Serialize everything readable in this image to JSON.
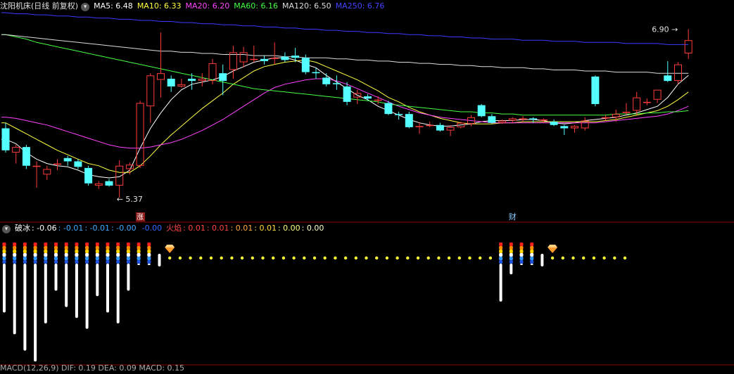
{
  "stock": {
    "title": "沈阳机床(日线 前复权)",
    "ma_legend": [
      {
        "label": "MA5: 6.48",
        "color": "#ffffff"
      },
      {
        "label": "MA10: 6.33",
        "color": "#ffff44"
      },
      {
        "label": "MA20: 6.20",
        "color": "#ff44ff"
      },
      {
        "label": "MA60: 6.16",
        "color": "#44ff44"
      },
      {
        "label": "MA120: 6.50",
        "color": "#dddddd"
      },
      {
        "label": "MA250: 6.76",
        "color": "#4444ff"
      }
    ],
    "high_label": "6.90",
    "low_label": "5.37",
    "markers": {
      "rise": "涨",
      "finance": "财"
    }
  },
  "indicator": {
    "name": "破冰",
    "values": [
      {
        "label": ": -0.06",
        "color": "#ffffff"
      },
      {
        "label": ": -0.01",
        "color": "#44aaff"
      },
      {
        "label": ": -0.01",
        "color": "#44aaff"
      },
      {
        "label": ": -0.00",
        "color": "#44aaff"
      },
      {
        "label": "-0.00",
        "color": "#3366ff"
      }
    ],
    "fire_name": "火焰",
    "fire_values": [
      {
        "label": ": 0.01",
        "color": "#ff4444"
      },
      {
        "label": ": 0.01",
        "color": "#ff4444"
      },
      {
        "label": ": 0.01",
        "color": "#ffaa44"
      },
      {
        "label": ": 0.01",
        "color": "#ffdd44"
      },
      {
        "label": ": 0.00",
        "color": "#ffff88"
      },
      {
        "label": ": 0.00",
        "color": "#ffffcc"
      }
    ],
    "bottom_text": "MACD(12,26,9)  DIF: 0.19  DEA: 0.09  MACD: 0.15"
  },
  "colors": {
    "up": "#ff3b3b",
    "down": "#54ffff",
    "bg": "#000000",
    "divider": "#8b0000"
  },
  "chart_data": [
    {
      "type": "candlestick",
      "title": "沈阳机床(日线 前复权)",
      "ylim": [
        5.25,
        7.05
      ],
      "candles": [
        {
          "o": 6.0,
          "h": 6.05,
          "l": 5.78,
          "c": 5.8
        },
        {
          "o": 5.78,
          "h": 5.85,
          "l": 5.68,
          "c": 5.83
        },
        {
          "o": 5.83,
          "h": 5.85,
          "l": 5.63,
          "c": 5.66
        },
        {
          "o": 5.66,
          "h": 5.7,
          "l": 5.46,
          "c": 5.66
        },
        {
          "o": 5.58,
          "h": 5.66,
          "l": 5.53,
          "c": 5.63
        },
        {
          "o": 5.68,
          "h": 5.72,
          "l": 5.62,
          "c": 5.68
        },
        {
          "o": 5.73,
          "h": 5.75,
          "l": 5.66,
          "c": 5.7
        },
        {
          "o": 5.7,
          "h": 5.72,
          "l": 5.63,
          "c": 5.65
        },
        {
          "o": 5.64,
          "h": 5.66,
          "l": 5.48,
          "c": 5.5
        },
        {
          "o": 5.48,
          "h": 5.52,
          "l": 5.45,
          "c": 5.5
        },
        {
          "o": 5.52,
          "h": 5.54,
          "l": 5.47,
          "c": 5.48
        },
        {
          "o": 5.48,
          "h": 5.71,
          "l": 5.37,
          "c": 5.66
        },
        {
          "o": 5.63,
          "h": 5.69,
          "l": 5.58,
          "c": 5.67
        },
        {
          "o": 5.66,
          "h": 6.25,
          "l": 5.64,
          "c": 6.23
        },
        {
          "o": 6.2,
          "h": 6.5,
          "l": 6.05,
          "c": 6.48
        },
        {
          "o": 6.44,
          "h": 6.87,
          "l": 6.28,
          "c": 6.5
        },
        {
          "o": 6.45,
          "h": 6.48,
          "l": 6.33,
          "c": 6.38
        },
        {
          "o": 6.38,
          "h": 6.45,
          "l": 6.37,
          "c": 6.4
        },
        {
          "o": 6.45,
          "h": 6.5,
          "l": 6.35,
          "c": 6.43
        },
        {
          "o": 6.43,
          "h": 6.5,
          "l": 6.38,
          "c": 6.45
        },
        {
          "o": 6.43,
          "h": 6.63,
          "l": 6.4,
          "c": 6.59
        },
        {
          "o": 6.5,
          "h": 6.58,
          "l": 6.3,
          "c": 6.43
        },
        {
          "o": 6.53,
          "h": 6.75,
          "l": 6.45,
          "c": 6.69
        },
        {
          "o": 6.6,
          "h": 6.74,
          "l": 6.55,
          "c": 6.69
        },
        {
          "o": 6.63,
          "h": 6.75,
          "l": 6.6,
          "c": 6.63
        },
        {
          "o": 6.63,
          "h": 6.66,
          "l": 6.58,
          "c": 6.61
        },
        {
          "o": 6.63,
          "h": 6.78,
          "l": 6.58,
          "c": 6.64
        },
        {
          "o": 6.65,
          "h": 6.69,
          "l": 6.6,
          "c": 6.62
        },
        {
          "o": 6.66,
          "h": 6.73,
          "l": 6.6,
          "c": 6.64
        },
        {
          "o": 6.64,
          "h": 6.67,
          "l": 6.49,
          "c": 6.51
        },
        {
          "o": 6.51,
          "h": 6.55,
          "l": 6.45,
          "c": 6.5
        },
        {
          "o": 6.46,
          "h": 6.5,
          "l": 6.38,
          "c": 6.4
        },
        {
          "o": 6.41,
          "h": 6.48,
          "l": 6.35,
          "c": 6.4
        },
        {
          "o": 6.38,
          "h": 6.42,
          "l": 6.21,
          "c": 6.24
        },
        {
          "o": 6.28,
          "h": 6.35,
          "l": 6.22,
          "c": 6.32
        },
        {
          "o": 6.29,
          "h": 6.31,
          "l": 6.25,
          "c": 6.27
        },
        {
          "o": 6.26,
          "h": 6.29,
          "l": 6.22,
          "c": 6.26
        },
        {
          "o": 6.23,
          "h": 6.25,
          "l": 6.12,
          "c": 6.13
        },
        {
          "o": 6.13,
          "h": 6.15,
          "l": 6.08,
          "c": 6.12
        },
        {
          "o": 6.13,
          "h": 6.15,
          "l": 6.0,
          "c": 6.01
        },
        {
          "o": 6.01,
          "h": 6.05,
          "l": 5.95,
          "c": 6.02
        },
        {
          "o": 6.03,
          "h": 6.06,
          "l": 6.01,
          "c": 6.03
        },
        {
          "o": 6.03,
          "h": 6.05,
          "l": 5.97,
          "c": 5.98
        },
        {
          "o": 5.98,
          "h": 6.03,
          "l": 5.93,
          "c": 6.01
        },
        {
          "o": 6.01,
          "h": 6.06,
          "l": 6.0,
          "c": 6.05
        },
        {
          "o": 6.04,
          "h": 6.12,
          "l": 6.02,
          "c": 6.1
        },
        {
          "o": 6.21,
          "h": 6.22,
          "l": 6.1,
          "c": 6.11
        },
        {
          "o": 6.11,
          "h": 6.13,
          "l": 6.04,
          "c": 6.05
        },
        {
          "o": 6.05,
          "h": 6.08,
          "l": 6.04,
          "c": 6.07
        },
        {
          "o": 6.07,
          "h": 6.1,
          "l": 6.05,
          "c": 6.09
        },
        {
          "o": 6.09,
          "h": 6.11,
          "l": 6.06,
          "c": 6.09
        },
        {
          "o": 6.09,
          "h": 6.1,
          "l": 6.05,
          "c": 6.08
        },
        {
          "o": 6.08,
          "h": 6.09,
          "l": 6.05,
          "c": 6.08
        },
        {
          "o": 6.06,
          "h": 6.08,
          "l": 6.02,
          "c": 6.03
        },
        {
          "o": 6.02,
          "h": 6.03,
          "l": 5.94,
          "c": 6.0
        },
        {
          "o": 6.0,
          "h": 6.03,
          "l": 5.96,
          "c": 6.02
        },
        {
          "o": 6.0,
          "h": 6.1,
          "l": 5.98,
          "c": 6.07
        },
        {
          "o": 6.47,
          "h": 6.48,
          "l": 6.2,
          "c": 6.22
        },
        {
          "o": 6.09,
          "h": 6.12,
          "l": 6.07,
          "c": 6.1
        },
        {
          "o": 6.1,
          "h": 6.17,
          "l": 6.06,
          "c": 6.13
        },
        {
          "o": 6.14,
          "h": 6.23,
          "l": 6.12,
          "c": 6.15
        },
        {
          "o": 6.16,
          "h": 6.33,
          "l": 6.12,
          "c": 6.28
        },
        {
          "o": 6.23,
          "h": 6.27,
          "l": 6.21,
          "c": 6.24
        },
        {
          "o": 6.26,
          "h": 6.35,
          "l": 6.23,
          "c": 6.35
        },
        {
          "o": 6.48,
          "h": 6.61,
          "l": 6.42,
          "c": 6.43
        },
        {
          "o": 6.43,
          "h": 6.6,
          "l": 6.4,
          "c": 6.58
        },
        {
          "o": 6.68,
          "h": 6.9,
          "l": 6.63,
          "c": 6.8
        }
      ],
      "ma": {
        "MA5": [
          5.9,
          5.86,
          5.78,
          5.72,
          5.68,
          5.66,
          5.65,
          5.62,
          5.58,
          5.56,
          5.55,
          5.56,
          5.62,
          5.82,
          6.0,
          6.14,
          6.26,
          6.35,
          6.4,
          6.42,
          6.44,
          6.47,
          6.52,
          6.56,
          6.6,
          6.62,
          6.64,
          6.64,
          6.62,
          6.58,
          6.55,
          6.48,
          6.42,
          6.36,
          6.3,
          6.26,
          6.2,
          6.16,
          6.12,
          6.08,
          6.05,
          6.03,
          6.02,
          6.02,
          6.03,
          6.04,
          6.06,
          6.07,
          6.07,
          6.07,
          6.08,
          6.08,
          6.07,
          6.05,
          6.04,
          6.05,
          6.07,
          6.08,
          6.09,
          6.1,
          6.12,
          6.14,
          6.17,
          6.2,
          6.28,
          6.4,
          6.48
        ],
        "MA10": [
          6.05,
          6.0,
          5.95,
          5.9,
          5.85,
          5.8,
          5.76,
          5.72,
          5.68,
          5.66,
          5.62,
          5.6,
          5.6,
          5.66,
          5.75,
          5.85,
          5.94,
          6.02,
          6.1,
          6.18,
          6.25,
          6.32,
          6.4,
          6.46,
          6.52,
          6.56,
          6.58,
          6.6,
          6.61,
          6.62,
          6.6,
          6.56,
          6.52,
          6.48,
          6.44,
          6.39,
          6.34,
          6.28,
          6.24,
          6.19,
          6.15,
          6.12,
          6.09,
          6.07,
          6.05,
          6.04,
          6.04,
          6.04,
          6.05,
          6.05,
          6.06,
          6.06,
          6.06,
          6.06,
          6.06,
          6.06,
          6.06,
          6.06,
          6.07,
          6.08,
          6.1,
          6.12,
          6.14,
          6.16,
          6.2,
          6.26,
          6.33
        ],
        "MA20": [
          6.1,
          6.09,
          6.07,
          6.05,
          6.03,
          6.0,
          5.97,
          5.94,
          5.91,
          5.88,
          5.85,
          5.83,
          5.82,
          5.82,
          5.83,
          5.85,
          5.87,
          5.9,
          5.94,
          5.98,
          6.03,
          6.08,
          6.14,
          6.2,
          6.26,
          6.32,
          6.37,
          6.4,
          6.42,
          6.44,
          6.45,
          6.45,
          6.43,
          6.4,
          6.36,
          6.32,
          6.28,
          6.24,
          6.2,
          6.17,
          6.14,
          6.12,
          6.1,
          6.09,
          6.08,
          6.07,
          6.06,
          6.05,
          6.05,
          6.05,
          6.05,
          6.05,
          6.05,
          6.05,
          6.05,
          6.05,
          6.05,
          6.05,
          6.06,
          6.07,
          6.08,
          6.09,
          6.1,
          6.11,
          6.13,
          6.16,
          6.2
        ],
        "MA60": [
          6.85,
          6.83,
          6.81,
          6.78,
          6.76,
          6.74,
          6.72,
          6.7,
          6.68,
          6.66,
          6.64,
          6.62,
          6.6,
          6.58,
          6.56,
          6.54,
          6.52,
          6.5,
          6.48,
          6.46,
          6.44,
          6.42,
          6.4,
          6.38,
          6.36,
          6.35,
          6.34,
          6.33,
          6.32,
          6.31,
          6.3,
          6.29,
          6.28,
          6.27,
          6.26,
          6.25,
          6.24,
          6.22,
          6.21,
          6.2,
          6.19,
          6.18,
          6.17,
          6.16,
          6.15,
          6.15,
          6.14,
          6.14,
          6.13,
          6.13,
          6.12,
          6.12,
          6.12,
          6.12,
          6.12,
          6.12,
          6.12,
          6.12,
          6.12,
          6.13,
          6.13,
          6.13,
          6.14,
          6.14,
          6.15,
          6.15,
          6.16
        ],
        "MA120": [
          6.85,
          6.84,
          6.83,
          6.82,
          6.81,
          6.8,
          6.79,
          6.78,
          6.77,
          6.76,
          6.75,
          6.74,
          6.73,
          6.72,
          6.71,
          6.7,
          6.7,
          6.69,
          6.69,
          6.68,
          6.68,
          6.67,
          6.67,
          6.67,
          6.66,
          6.66,
          6.66,
          6.65,
          6.65,
          6.64,
          6.64,
          6.64,
          6.63,
          6.63,
          6.62,
          6.62,
          6.61,
          6.61,
          6.6,
          6.6,
          6.59,
          6.59,
          6.58,
          6.58,
          6.57,
          6.57,
          6.56,
          6.56,
          6.55,
          6.55,
          6.55,
          6.54,
          6.54,
          6.53,
          6.53,
          6.53,
          6.52,
          6.52,
          6.52,
          6.51,
          6.51,
          6.51,
          6.51,
          6.5,
          6.5,
          6.5,
          6.5
        ],
        "MA250": [
          7.05,
          7.04,
          7.04,
          7.03,
          7.03,
          7.02,
          7.02,
          7.01,
          7.01,
          7.0,
          7.0,
          6.99,
          6.99,
          6.98,
          6.98,
          6.97,
          6.97,
          6.96,
          6.96,
          6.95,
          6.95,
          6.94,
          6.94,
          6.93,
          6.93,
          6.92,
          6.92,
          6.91,
          6.91,
          6.9,
          6.9,
          6.89,
          6.89,
          6.88,
          6.88,
          6.87,
          6.87,
          6.86,
          6.86,
          6.85,
          6.85,
          6.84,
          6.84,
          6.83,
          6.83,
          6.82,
          6.82,
          6.81,
          6.81,
          6.81,
          6.8,
          6.8,
          6.8,
          6.79,
          6.79,
          6.79,
          6.78,
          6.78,
          6.78,
          6.78,
          6.77,
          6.77,
          6.77,
          6.77,
          6.76,
          6.76,
          6.76
        ]
      }
    },
    {
      "type": "bar",
      "title": "破冰",
      "ylim": [
        -1,
        0.1
      ],
      "values": [
        -0.5,
        -0.7,
        -0.85,
        -0.95,
        -0.6,
        -0.3,
        -0.45,
        -0.55,
        -0.65,
        -0.35,
        -0.5,
        -0.6,
        -0.3,
        -0.05,
        -0.03,
        -0.01,
        0.0,
        0.0,
        0.0,
        0.0,
        0.0,
        0.0,
        0.0,
        0.0,
        0.0,
        0.0,
        0.0,
        0.0,
        0.0,
        0.0,
        0.0,
        0.0,
        0.0,
        0.0,
        0.0,
        0.0,
        0.0,
        0.0,
        0.0,
        0.0,
        0.0,
        0.0,
        0.0,
        0.0,
        0.0,
        0.0,
        0.0,
        0.0,
        -0.4,
        -0.15,
        -0.06,
        -0.03,
        -0.01,
        0.0,
        0.0,
        0.0,
        0.0,
        0.0,
        0.0,
        0.0,
        0.0
      ],
      "gem_indices": [
        16,
        53
      ]
    }
  ]
}
